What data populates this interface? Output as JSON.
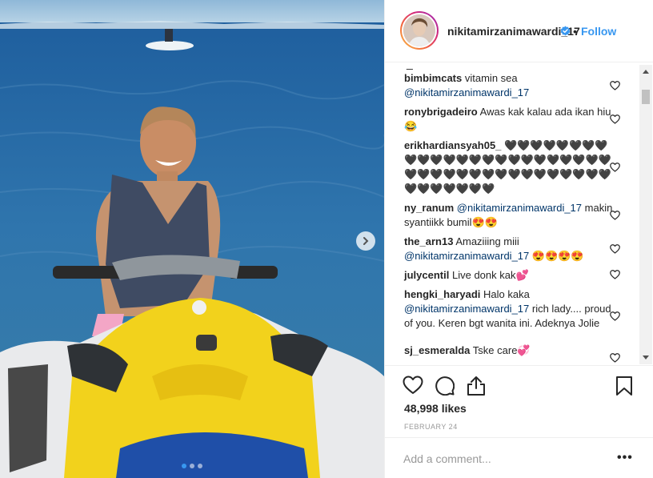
{
  "post": {
    "username": "nikitamirzanimawardi_17",
    "follow_label": "Follow",
    "separator": "•",
    "likes": "48,998 likes",
    "date": "FEBRUARY 24",
    "photo_carousel": {
      "slides": 3,
      "active_slide": 1
    }
  },
  "comments_top_fragment": "_",
  "comments": [
    {
      "user": "bimbimcats",
      "parts": [
        {
          "t": "vitamin sea "
        },
        {
          "t": "@nikitamirzanimawardi_17",
          "m": true
        }
      ]
    },
    {
      "user": "ronybrigadeiro",
      "parts": [
        {
          "t": "Awas kak kalau ada ikan hiu😂"
        }
      ]
    },
    {
      "user": "erikhardiansyah05_",
      "parts": [
        {
          "t": "🖤🖤🖤🖤🖤🖤🖤🖤🖤🖤🖤🖤🖤🖤🖤🖤🖤🖤🖤🖤🖤🖤🖤🖤🖤🖤🖤🖤🖤🖤🖤🖤🖤🖤🖤🖤🖤🖤🖤🖤🖤🖤🖤🖤🖤🖤🖤"
        }
      ]
    },
    {
      "user": "ny_ranum",
      "parts": [
        {
          "t": "@nikitamirzanimawardi_17",
          "m": true
        },
        {
          "t": " makin syantiikk bumil😍😍"
        }
      ]
    },
    {
      "user": "the_arn13",
      "parts": [
        {
          "t": "Amaziiing miii "
        },
        {
          "t": "@nikitamirzanimawardi_17",
          "m": true
        },
        {
          "t": " 😍😍😍😍"
        }
      ]
    },
    {
      "user": "julycentil",
      "parts": [
        {
          "t": "Live donk kak💕"
        }
      ]
    },
    {
      "user": "hengki_haryadi",
      "parts": [
        {
          "t": "Halo kaka "
        },
        {
          "t": "@nikitamirzanimawardi_17",
          "m": true
        },
        {
          "t": " rich lady.... proud of you. Keren bgt wanita ini. Adeknya Jolie"
        }
      ]
    },
    {
      "user": "sj_esmeralda",
      "parts": [
        {
          "t": "Tske care💞"
        }
      ]
    }
  ],
  "add_comment": {
    "placeholder": "Add a comment...",
    "more_label": "•••"
  },
  "icons": {
    "like": "heart-outline-icon",
    "comment": "speech-bubble-icon",
    "share": "share-upload-icon",
    "save": "bookmark-icon",
    "verified": "verified-badge-icon",
    "next": "chevron-right-icon"
  },
  "colors": {
    "link_blue": "#3897f0",
    "mention": "#003569",
    "text": "#262626",
    "muted": "#999999"
  }
}
